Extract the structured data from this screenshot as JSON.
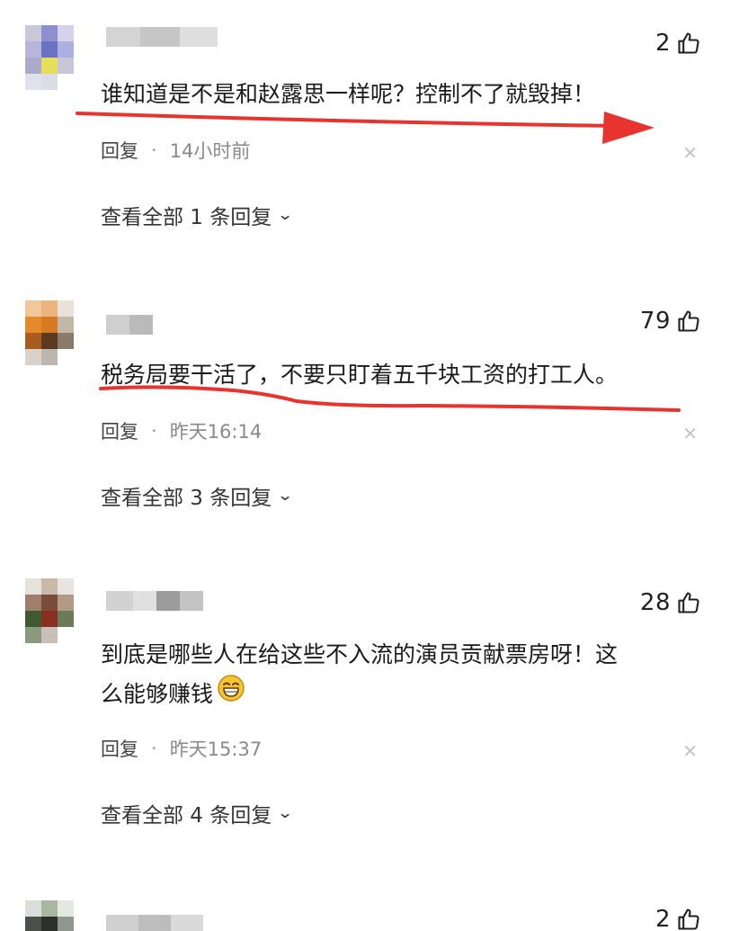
{
  "comments": [
    {
      "likes": "2",
      "text": "谁知道是不是和赵露思一样呢？控制不了就毁掉！",
      "reply_label": "回复",
      "separator": "·",
      "time": "14小时前",
      "view_replies": "查看全部 1 条回复"
    },
    {
      "likes": "79",
      "text": "税务局要干活了，不要只盯着五千块工资的打工人。",
      "reply_label": "回复",
      "separator": "·",
      "time": "昨天16:14",
      "view_replies": "查看全部 3 条回复"
    },
    {
      "likes": "28",
      "text_line1": "到底是哪些人在给这些不入流的演员贡献票房呀！这",
      "text_line2": "么能够赚钱",
      "emoji": "grinning-face-emoji",
      "reply_label": "回复",
      "separator": "·",
      "time": "昨天15:37",
      "view_replies": "查看全部 4 条回复"
    },
    {
      "likes": "2"
    }
  ],
  "icons": {
    "like": "thumbs-up-icon",
    "close": "close-icon",
    "chevron": "chevron-down-icon"
  },
  "colors": {
    "annotation_red": "#e8332e",
    "text": "#1a1a1a",
    "muted": "#8a8a8a"
  }
}
